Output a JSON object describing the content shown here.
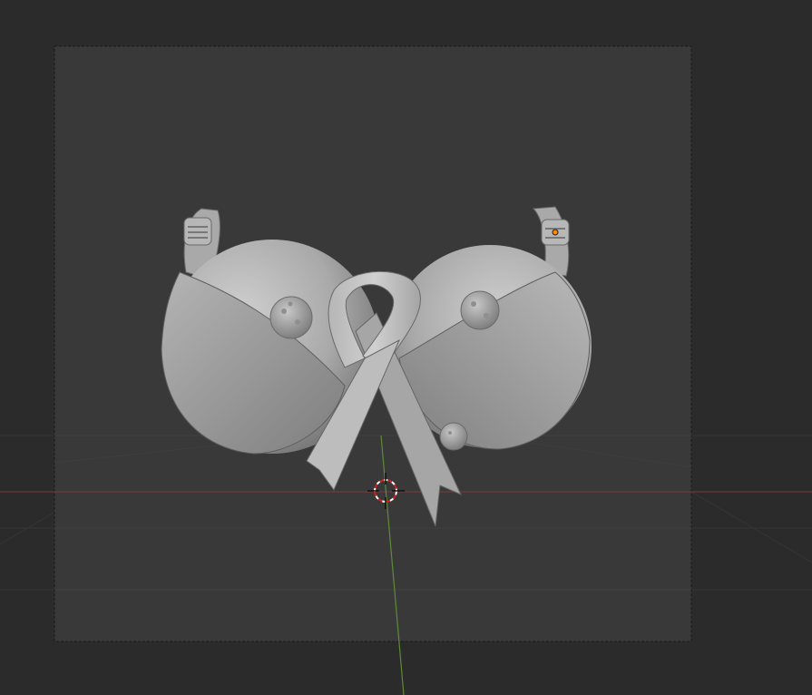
{
  "app": {
    "name": "3D Viewport",
    "mode": "object",
    "shading": "solid"
  },
  "viewport": {
    "background_color": "#2b2b2b",
    "camera_frame_color": "#393939",
    "camera_frame_border_color": "#1a1a1a",
    "grid_line_color": "#3a3a3a",
    "x_axis_color": "#7a3a3a",
    "y_axis_color": "#5f8a3a",
    "origin_marker_color": "#ff8a00"
  },
  "scene": {
    "objects": [
      {
        "name": "bra-cup-left",
        "type": "mesh"
      },
      {
        "name": "bra-cup-right",
        "type": "mesh"
      },
      {
        "name": "awareness-ribbon",
        "type": "mesh"
      },
      {
        "name": "tumor-lump-left",
        "type": "mesh"
      },
      {
        "name": "tumor-lump-right",
        "type": "mesh"
      },
      {
        "name": "tumor-lump-small",
        "type": "mesh"
      },
      {
        "name": "strap-left",
        "type": "mesh"
      },
      {
        "name": "strap-right",
        "type": "mesh"
      }
    ],
    "cursor_3d": "3d-cursor-icon"
  }
}
